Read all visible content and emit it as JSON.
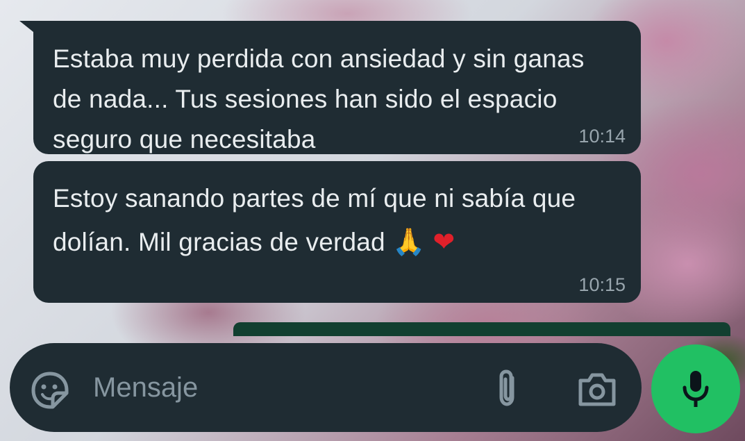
{
  "messages": [
    {
      "text": "Estaba muy perdida con ansiedad y sin ganas de nada... Tus sesiones han sido el espacio seguro que necesitaba",
      "time": "10:14"
    },
    {
      "text": "Estoy sanando partes de mí que ni sabía que dolían. Mil gracias de verdad",
      "emojis": [
        "🙏",
        "❤"
      ],
      "time": "10:15"
    }
  ],
  "composer": {
    "placeholder": "Mensaje",
    "icons": [
      "sticker-icon",
      "paperclip-icon",
      "camera-icon",
      "microphone-icon"
    ]
  },
  "colors": {
    "bubble": "#1f2c33",
    "text": "#e9edef",
    "timestamp": "#98a5ad",
    "mic_button": "#21c063"
  }
}
